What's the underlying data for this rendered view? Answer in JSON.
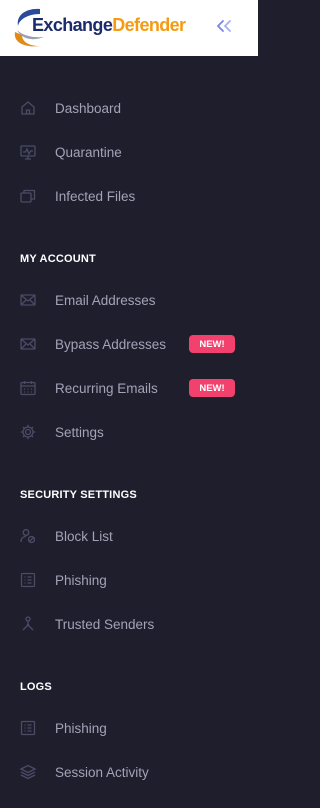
{
  "header": {
    "logo_text_part1": "Exchange",
    "logo_text_part2": "Defender",
    "collapse_icon": "double-chevron-left-icon"
  },
  "colors": {
    "sidebar_bg": "#1e1e2d",
    "label": "#a2a3b7",
    "badge": "#f1416c",
    "accent": "#7c83e8",
    "logo_blue": "#1c2b6b",
    "logo_orange": "#f39c12"
  },
  "nav_top": [
    {
      "label": "Dashboard",
      "icon": "home-icon"
    },
    {
      "label": "Quarantine",
      "icon": "monitor-icon"
    },
    {
      "label": "Infected Files",
      "icon": "copy-icon"
    }
  ],
  "sections": [
    {
      "title": "MY ACCOUNT",
      "items": [
        {
          "label": "Email Addresses",
          "icon": "envelope-icon"
        },
        {
          "label": "Bypass Addresses",
          "icon": "envelope-icon",
          "badge": "NEW!"
        },
        {
          "label": "Recurring Emails",
          "icon": "calendar-icon",
          "badge": "NEW!"
        },
        {
          "label": "Settings",
          "icon": "gear-icon"
        }
      ]
    },
    {
      "title": "SECURITY SETTINGS",
      "items": [
        {
          "label": "Block List",
          "icon": "user-block-icon"
        },
        {
          "label": "Phishing",
          "icon": "list-icon"
        },
        {
          "label": "Trusted Senders",
          "icon": "hierarchy-icon"
        }
      ]
    },
    {
      "title": "LOGS",
      "items": [
        {
          "label": "Phishing",
          "icon": "list-icon"
        },
        {
          "label": "Session Activity",
          "icon": "layers-icon"
        }
      ]
    }
  ]
}
